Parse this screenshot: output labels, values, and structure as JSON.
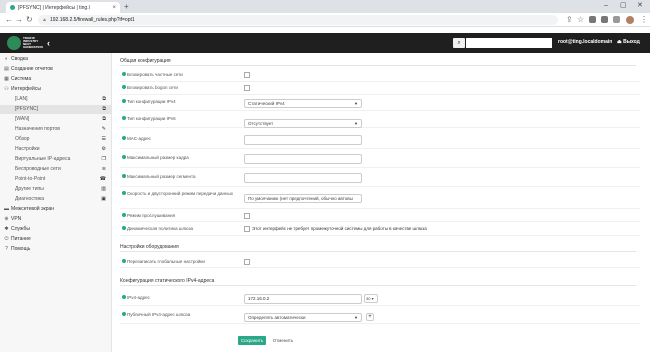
{
  "browser": {
    "tab_title": "[PFSYNC] | Интерфейсы | ting.l",
    "url": "192.168.2.5/firewall_rules.php?if=opt1"
  },
  "header": {
    "logo_text": "TINGFW INDUSTRY NEXT GENERATION",
    "user": "root@ting.localdomain",
    "logout": "Выход"
  },
  "sidebar": {
    "items": [
      {
        "label": "Сводка",
        "icon": "dashboard-icon"
      },
      {
        "label": "Создание отчетов",
        "icon": "reports-icon"
      },
      {
        "label": "Система",
        "icon": "system-icon"
      },
      {
        "label": "Интерфейсы",
        "icon": "interfaces-icon"
      },
      {
        "label": "[LAN]"
      },
      {
        "label": "[PFSYNC]"
      },
      {
        "label": "[WAN]"
      },
      {
        "label": "Назначения портов"
      },
      {
        "label": "Обзор"
      },
      {
        "label": "Настройки"
      },
      {
        "label": "Виртуальные IP-адреса"
      },
      {
        "label": "Беспроводные сети"
      },
      {
        "label": "Point-to-Point"
      },
      {
        "label": "Другие типы"
      },
      {
        "label": "Диагностика"
      },
      {
        "label": "Межсетевой экран",
        "icon": "firewall-icon"
      },
      {
        "label": "VPN",
        "icon": "vpn-icon"
      },
      {
        "label": "Службы",
        "icon": "services-icon"
      },
      {
        "label": "Питание",
        "icon": "power-icon"
      },
      {
        "label": "Помощь",
        "icon": "help-icon"
      }
    ]
  },
  "general": {
    "heading": "Общая конфигурация",
    "block_private": "Блокировать частные сети",
    "block_bogon": "Блокировать bogon сети",
    "ipv4_type_label": "Тип конфигурации IPv4",
    "ipv4_type_value": "Статический IPv4",
    "ipv6_type_label": "Тип конфигурации IPv6",
    "ipv6_type_value": "Отсутствует",
    "mac_label": "MAC-адрес",
    "mtu_label": "Максимальный размер кадра",
    "mss_label": "Максимальный размер сегмента",
    "speed_label": "Скорость и двусторонний режим передачи данных",
    "speed_value": "По умолчанию (нет предпочтений, обычно автовы",
    "promisc_label": "Режим прослушивания",
    "gw_policy_label": "Динамическая политика шлюза",
    "gw_policy_note": "Этот интерфейс не требует промежуточной системы для работы в качестве шлюза"
  },
  "hardware": {
    "heading": "Настройки оборудования",
    "override_label": "Перезаписать глобальные настройки"
  },
  "static_ipv4": {
    "heading": "Конфигурация статического IPv4-адреса",
    "ip_label": "IPv4-адрес",
    "ip_value": "172.16.0.2",
    "cidr_value": "30",
    "gw_label": "Публичный IPv4-адрес шлюза",
    "gw_value": "Определять автоматически"
  },
  "buttons": {
    "save": "Сохранить",
    "cancel": "Отменить"
  }
}
